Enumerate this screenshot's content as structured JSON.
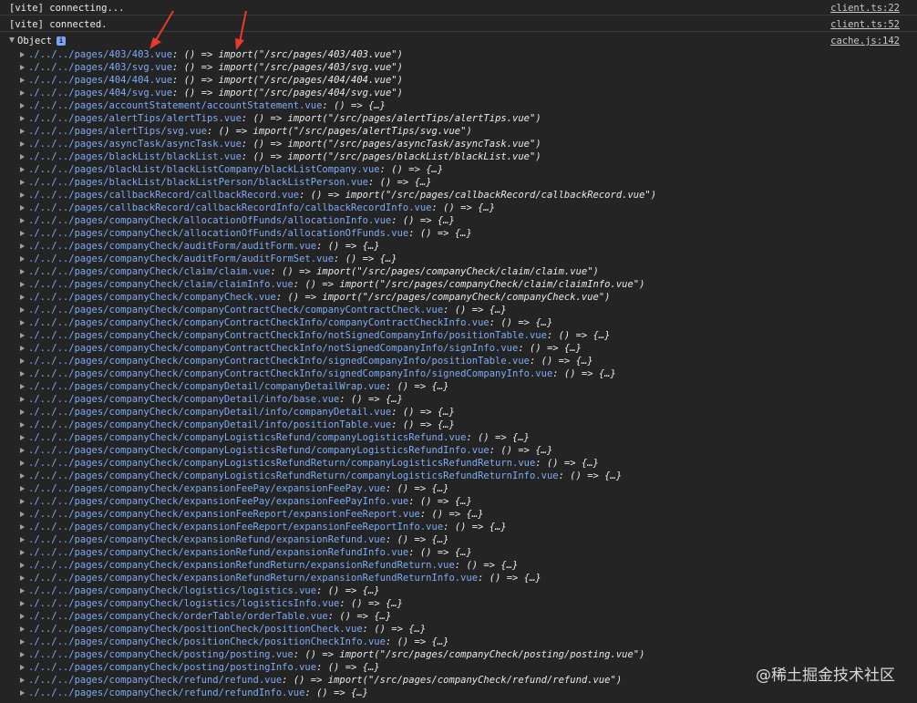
{
  "console": {
    "logs": [
      {
        "message": "[vite] connecting...",
        "source": "client.ts:22"
      },
      {
        "message": "[vite] connected.",
        "source": "client.ts:52"
      }
    ],
    "object_label": "Object",
    "object_source": "cache.js:142",
    "entries": [
      {
        "key": "./../../pages/403/403.vue",
        "value": "() => import(\"/src/pages/403/403.vue\")"
      },
      {
        "key": "./../../pages/403/svg.vue",
        "value": "() => import(\"/src/pages/403/svg.vue\")"
      },
      {
        "key": "./../../pages/404/404.vue",
        "value": "() => import(\"/src/pages/404/404.vue\")"
      },
      {
        "key": "./../../pages/404/svg.vue",
        "value": "() => import(\"/src/pages/404/svg.vue\")"
      },
      {
        "key": "./../../pages/accountStatement/accountStatement.vue",
        "value": "() => {…}"
      },
      {
        "key": "./../../pages/alertTips/alertTips.vue",
        "value": "() => import(\"/src/pages/alertTips/alertTips.vue\")"
      },
      {
        "key": "./../../pages/alertTips/svg.vue",
        "value": "() => import(\"/src/pages/alertTips/svg.vue\")"
      },
      {
        "key": "./../../pages/asyncTask/asyncTask.vue",
        "value": "() => import(\"/src/pages/asyncTask/asyncTask.vue\")"
      },
      {
        "key": "./../../pages/blackList/blackList.vue",
        "value": "() => import(\"/src/pages/blackList/blackList.vue\")"
      },
      {
        "key": "./../../pages/blackList/blackListCompany/blackListCompany.vue",
        "value": "() => {…}"
      },
      {
        "key": "./../../pages/blackList/blackListPerson/blackListPerson.vue",
        "value": "() => {…}"
      },
      {
        "key": "./../../pages/callbackRecord/callbackRecord.vue",
        "value": "() => import(\"/src/pages/callbackRecord/callbackRecord.vue\")"
      },
      {
        "key": "./../../pages/callbackRecord/callbackRecordInfo/callbackRecordInfo.vue",
        "value": "() => {…}"
      },
      {
        "key": "./../../pages/companyCheck/allocationOfFunds/allocationInfo.vue",
        "value": "() => {…}"
      },
      {
        "key": "./../../pages/companyCheck/allocationOfFunds/allocationOfFunds.vue",
        "value": "() => {…}"
      },
      {
        "key": "./../../pages/companyCheck/auditForm/auditForm.vue",
        "value": "() => {…}"
      },
      {
        "key": "./../../pages/companyCheck/auditForm/auditFormSet.vue",
        "value": "() => {…}"
      },
      {
        "key": "./../../pages/companyCheck/claim/claim.vue",
        "value": "() => import(\"/src/pages/companyCheck/claim/claim.vue\")"
      },
      {
        "key": "./../../pages/companyCheck/claim/claimInfo.vue",
        "value": "() => import(\"/src/pages/companyCheck/claim/claimInfo.vue\")"
      },
      {
        "key": "./../../pages/companyCheck/companyCheck.vue",
        "value": "() => import(\"/src/pages/companyCheck/companyCheck.vue\")"
      },
      {
        "key": "./../../pages/companyCheck/companyContractCheck/companyContractCheck.vue",
        "value": "() => {…}"
      },
      {
        "key": "./../../pages/companyCheck/companyContractCheckInfo/companyContractCheckInfo.vue",
        "value": "() => {…}"
      },
      {
        "key": "./../../pages/companyCheck/companyContractCheckInfo/notSignedCompanyInfo/positionTable.vue",
        "value": "() => {…}"
      },
      {
        "key": "./../../pages/companyCheck/companyContractCheckInfo/notSignedCompanyInfo/signInfo.vue",
        "value": "() => {…}"
      },
      {
        "key": "./../../pages/companyCheck/companyContractCheckInfo/signedCompanyInfo/positionTable.vue",
        "value": "() => {…}"
      },
      {
        "key": "./../../pages/companyCheck/companyContractCheckInfo/signedCompanyInfo/signedCompanyInfo.vue",
        "value": "() => {…}"
      },
      {
        "key": "./../../pages/companyCheck/companyDetail/companyDetailWrap.vue",
        "value": "() => {…}"
      },
      {
        "key": "./../../pages/companyCheck/companyDetail/info/base.vue",
        "value": "() => {…}"
      },
      {
        "key": "./../../pages/companyCheck/companyDetail/info/companyDetail.vue",
        "value": "() => {…}"
      },
      {
        "key": "./../../pages/companyCheck/companyDetail/info/positionTable.vue",
        "value": "() => {…}"
      },
      {
        "key": "./../../pages/companyCheck/companyLogisticsRefund/companyLogisticsRefund.vue",
        "value": "() => {…}"
      },
      {
        "key": "./../../pages/companyCheck/companyLogisticsRefund/companyLogisticsRefundInfo.vue",
        "value": "() => {…}"
      },
      {
        "key": "./../../pages/companyCheck/companyLogisticsRefundReturn/companyLogisticsRefundReturn.vue",
        "value": "() => {…}"
      },
      {
        "key": "./../../pages/companyCheck/companyLogisticsRefundReturn/companyLogisticsRefundReturnInfo.vue",
        "value": "() => {…}"
      },
      {
        "key": "./../../pages/companyCheck/expansionFeePay/expansionFeePay.vue",
        "value": "() => {…}"
      },
      {
        "key": "./../../pages/companyCheck/expansionFeePay/expansionFeePayInfo.vue",
        "value": "() => {…}"
      },
      {
        "key": "./../../pages/companyCheck/expansionFeeReport/expansionFeeReport.vue",
        "value": "() => {…}"
      },
      {
        "key": "./../../pages/companyCheck/expansionFeeReport/expansionFeeReportInfo.vue",
        "value": "() => {…}"
      },
      {
        "key": "./../../pages/companyCheck/expansionRefund/expansionRefund.vue",
        "value": "() => {…}"
      },
      {
        "key": "./../../pages/companyCheck/expansionRefund/expansionRefundInfo.vue",
        "value": "() => {…}"
      },
      {
        "key": "./../../pages/companyCheck/expansionRefundReturn/expansionRefundReturn.vue",
        "value": "() => {…}"
      },
      {
        "key": "./../../pages/companyCheck/expansionRefundReturn/expansionRefundReturnInfo.vue",
        "value": "() => {…}"
      },
      {
        "key": "./../../pages/companyCheck/logistics/logistics.vue",
        "value": "() => {…}"
      },
      {
        "key": "./../../pages/companyCheck/logistics/logisticsInfo.vue",
        "value": "() => {…}"
      },
      {
        "key": "./../../pages/companyCheck/orderTable/orderTable.vue",
        "value": "() => {…}"
      },
      {
        "key": "./../../pages/companyCheck/positionCheck/positionCheck.vue",
        "value": "() => {…}"
      },
      {
        "key": "./../../pages/companyCheck/positionCheck/positionCheckInfo.vue",
        "value": "() => {…}"
      },
      {
        "key": "./../../pages/companyCheck/posting/posting.vue",
        "value": "() => import(\"/src/pages/companyCheck/posting/posting.vue\")"
      },
      {
        "key": "./../../pages/companyCheck/posting/postingInfo.vue",
        "value": "() => {…}"
      },
      {
        "key": "./../../pages/companyCheck/refund/refund.vue",
        "value": "() => import(\"/src/pages/companyCheck/refund/refund.vue\")"
      },
      {
        "key": "./../../pages/companyCheck/refund/refundInfo.vue",
        "value": "() => {…}"
      }
    ]
  },
  "watermark": "@稀土掘金技术社区",
  "colors": {
    "background": "#242424",
    "key": "#7cacf8",
    "annotation_arrow": "#e8392c"
  }
}
